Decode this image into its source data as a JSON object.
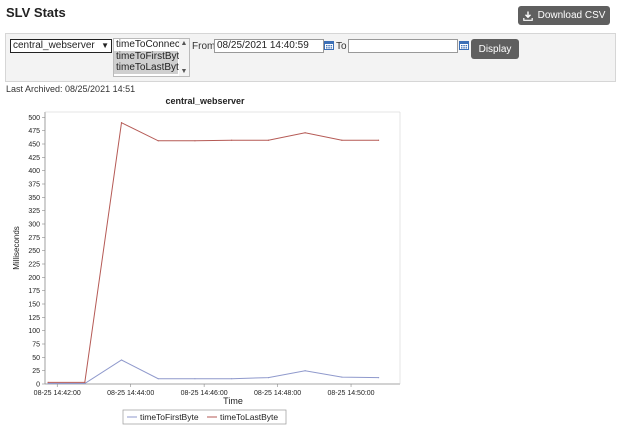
{
  "page": {
    "title": "SLV Stats"
  },
  "toolbar": {
    "download_label": "Download CSV"
  },
  "filters": {
    "server_select": "central_webserver",
    "metrics": [
      "timeToConnect",
      "timeToFirstByte",
      "timeToLastByte"
    ],
    "selected_metrics": [
      "timeToFirstByte",
      "timeToLastByte"
    ],
    "from_label": "From",
    "from_value": "08/25/2021 14:40:59",
    "to_label": "To",
    "to_value": "",
    "display_label": "Display"
  },
  "status": {
    "last_archived": "Last Archived: 08/25/2021 14:51"
  },
  "colors": {
    "button_bg": "#5f5f5f",
    "panel_bg": "#f3f3f3",
    "calendar_icon": "#3b6fb6",
    "series_first_byte": "#8f99cc",
    "series_last_byte": "#b55a55"
  },
  "icons": {
    "download": "download-icon",
    "calendar": "calendar-icon"
  },
  "chart_data": {
    "type": "line",
    "title": "central_webserver",
    "xlabel": "Time",
    "ylabel": "Milliseconds",
    "xlim": [
      "08-25 14:41:40",
      "08-25 14:51:20"
    ],
    "ylim": [
      0,
      510
    ],
    "y_ticks": [
      0,
      25,
      50,
      75,
      100,
      125,
      150,
      175,
      200,
      225,
      250,
      275,
      300,
      325,
      350,
      375,
      400,
      425,
      450,
      475,
      500
    ],
    "x_ticks": [
      "08-25 14:42:00",
      "08-25 14:44:00",
      "08-25 14:46:00",
      "08-25 14:48:00",
      "08-25 14:50:00"
    ],
    "grid": false,
    "legend_position": "bottom",
    "x": [
      "08-25 14:41:45",
      "08-25 14:42:45",
      "08-25 14:43:45",
      "08-25 14:44:45",
      "08-25 14:45:45",
      "08-25 14:46:45",
      "08-25 14:47:45",
      "08-25 14:48:45",
      "08-25 14:49:45",
      "08-25 14:50:45"
    ],
    "series": [
      {
        "name": "timeToFirstByte",
        "color": "#8f99cc",
        "values": [
          1,
          1,
          45,
          10,
          10,
          10,
          12,
          25,
          13,
          12
        ]
      },
      {
        "name": "timeToLastByte",
        "color": "#b55a55",
        "values": [
          3,
          3,
          490,
          456,
          456,
          457,
          457,
          471,
          457,
          457
        ]
      }
    ]
  }
}
